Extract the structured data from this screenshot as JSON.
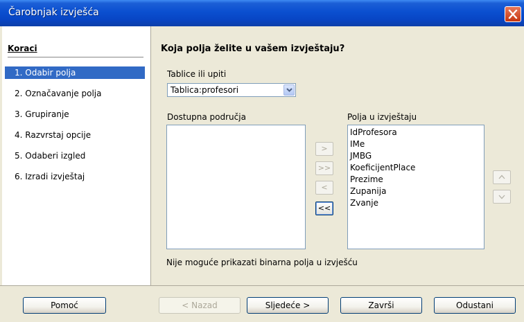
{
  "window": {
    "title": "Čarobnjak izvješća",
    "accent": "#0a4fd0"
  },
  "steps": {
    "title": "Koraci",
    "items": [
      {
        "label": "1. Odabir polja",
        "active": true
      },
      {
        "label": "2. Označavanje polja",
        "active": false
      },
      {
        "label": "3. Grupiranje",
        "active": false
      },
      {
        "label": "4. Razvrstaj opcije",
        "active": false
      },
      {
        "label": "5. Odaberi izgled",
        "active": false
      },
      {
        "label": "6. Izradi izvještaj",
        "active": false
      }
    ]
  },
  "main": {
    "heading": "Koja polja želite u vašem izvještaju?",
    "tables_label": "Tablice ili upiti",
    "tables_value": "Tablica:profesori",
    "available_label": "Dostupna područja",
    "available_items": [],
    "report_label": "Polja u izvještaju",
    "report_items": [
      "IdProfesora",
      "IMe",
      "JMBG",
      "KoeficijentPlace",
      "Prezime",
      "Zupanija",
      "Zvanje"
    ],
    "move_buttons": {
      "add_one": ">",
      "add_all": ">>",
      "remove_one": "<",
      "remove_all": "<<"
    },
    "order_buttons": {
      "up": "^",
      "down": "v"
    },
    "note": "Nije moguće prikazati binarna polja u izvješću"
  },
  "footer": {
    "help": "Pomoć",
    "back": "< Nazad",
    "next": "Sljedeće >",
    "finish": "Završi",
    "cancel": "Odustani"
  }
}
